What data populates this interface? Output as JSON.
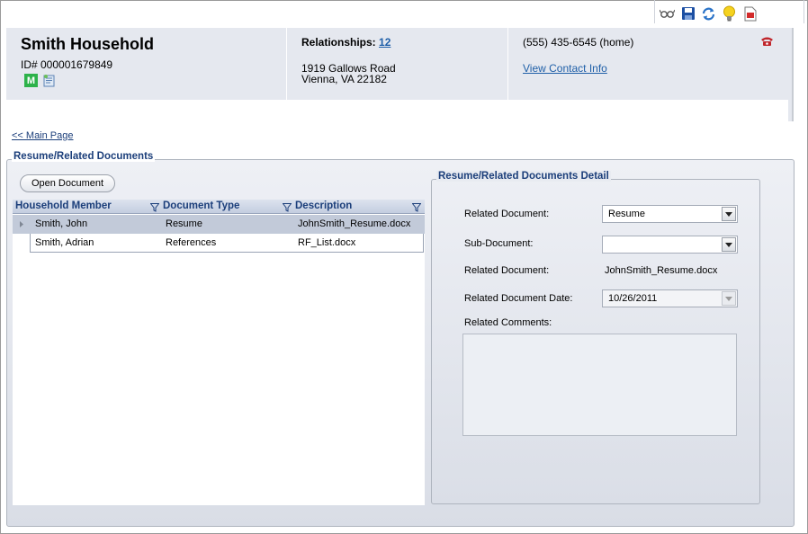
{
  "toolbar": {
    "icons": [
      "glasses-icon",
      "save-icon",
      "refresh-icon",
      "lightbulb-icon",
      "pdf-icon"
    ]
  },
  "header": {
    "title": "Smith Household",
    "id_label": "ID# 000001679849",
    "badge_m": "M",
    "relationships_label": "Relationships:",
    "relationships_count": "12",
    "address_line1": "1919 Gallows Road",
    "address_line2": "Vienna, VA 22182",
    "phone": "(555) 435-6545 (home)",
    "contact_link": "View Contact Info"
  },
  "nav": {
    "main_page_link": "<< Main Page"
  },
  "section": {
    "legend": "Resume/Related Documents",
    "open_button": "Open Document"
  },
  "grid": {
    "columns": [
      "Household Member",
      "Document Type",
      "Description"
    ],
    "rows": [
      {
        "member": "Smith, John",
        "type": "Resume",
        "description": "JohnSmith_Resume.docx",
        "selected": true
      },
      {
        "member": "Smith, Adrian",
        "type": "References",
        "description": "RF_List.docx",
        "selected": false
      }
    ]
  },
  "detail": {
    "legend": "Resume/Related Documents Detail",
    "related_document_label": "Related Document:",
    "related_document_value": "Resume",
    "sub_document_label": "Sub-Document:",
    "sub_document_value": "",
    "related_document2_label": "Related Document:",
    "related_document2_value": "JohnSmith_Resume.docx",
    "date_label": "Related Document Date:",
    "date_value": "10/26/2011",
    "comments_label": "Related Comments:",
    "comments_value": ""
  },
  "colors": {
    "link": "#1f5fa8",
    "header_bg": "#e5e8ef",
    "legend_text": "#1b3e7a",
    "badge_green": "#2db24a"
  }
}
